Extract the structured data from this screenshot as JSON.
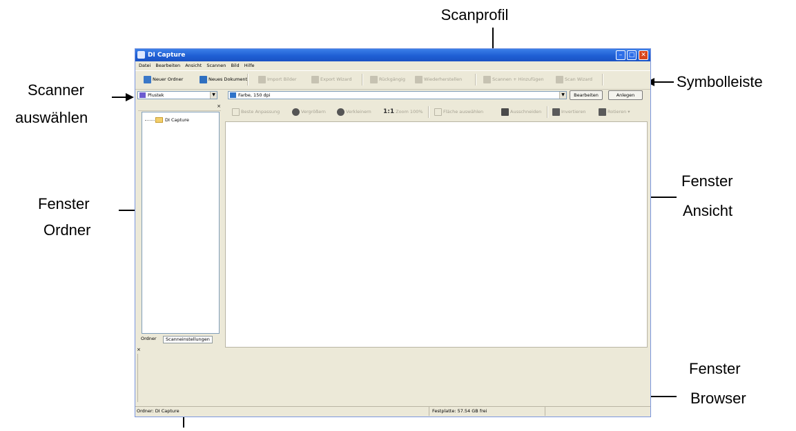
{
  "annotations": {
    "scanprofil": "Scanprofil",
    "symbolleiste": "Symbolleiste",
    "scanner_line1": "Scanner",
    "scanner_line2": "auswählen",
    "fenster_ordner_line1": "Fenster",
    "fenster_ordner_line2": "Ordner",
    "fenster_ansicht_line1": "Fenster",
    "fenster_ansicht_line2": "Ansicht",
    "fenster_browser_line1": "Fenster",
    "fenster_browser_line2": "Browser"
  },
  "window": {
    "title": "DI Capture",
    "controls": {
      "minimize": "–",
      "maximize": "□",
      "close": "✕"
    }
  },
  "menu": [
    "Datei",
    "Bearbeiten",
    "Ansicht",
    "Scannen",
    "Bild",
    "Hilfe"
  ],
  "toolbar": {
    "new_folder": "Neuer Ordner",
    "new_document": "Neues Dokument",
    "import_images": "Import Bilder",
    "export_wizard": "Export Wizard",
    "undo": "Rückgängig",
    "redo": "Wiederherstellen",
    "scan_add": "Scannen + Hinzufügen",
    "scan_wizard": "Scan Wizard"
  },
  "scanner_bar": {
    "scanner_value": "Plustek",
    "profile_value": "Farbe, 150 dpi",
    "edit_button": "Bearbeiten",
    "create_button": "Anlegen"
  },
  "folder_pane": {
    "close": "×",
    "tree_root": "DI Capture",
    "tabs": [
      "Ordner",
      "Scanneinstellungen"
    ]
  },
  "view_toolbar": {
    "best_fit": "Beste Anpassung",
    "zoom_in": "Vergrößern",
    "zoom_out": "Verkleinern",
    "zoom_label": "1:1",
    "zoom_100": "Zoom 100%",
    "select_area": "Fläche auswählen",
    "crop": "Ausschneiden",
    "invert": "Invertieren",
    "rotate": "Rotieren"
  },
  "browser_pane": {
    "close": "×"
  },
  "status": {
    "folder": "Ordner: DI Capture",
    "disk": "Festplatte: 57.54 GB frei"
  },
  "colors": {
    "titlebar": "#1f5fd4",
    "window_bg": "#ece9d8",
    "close_button": "#d8461c"
  }
}
